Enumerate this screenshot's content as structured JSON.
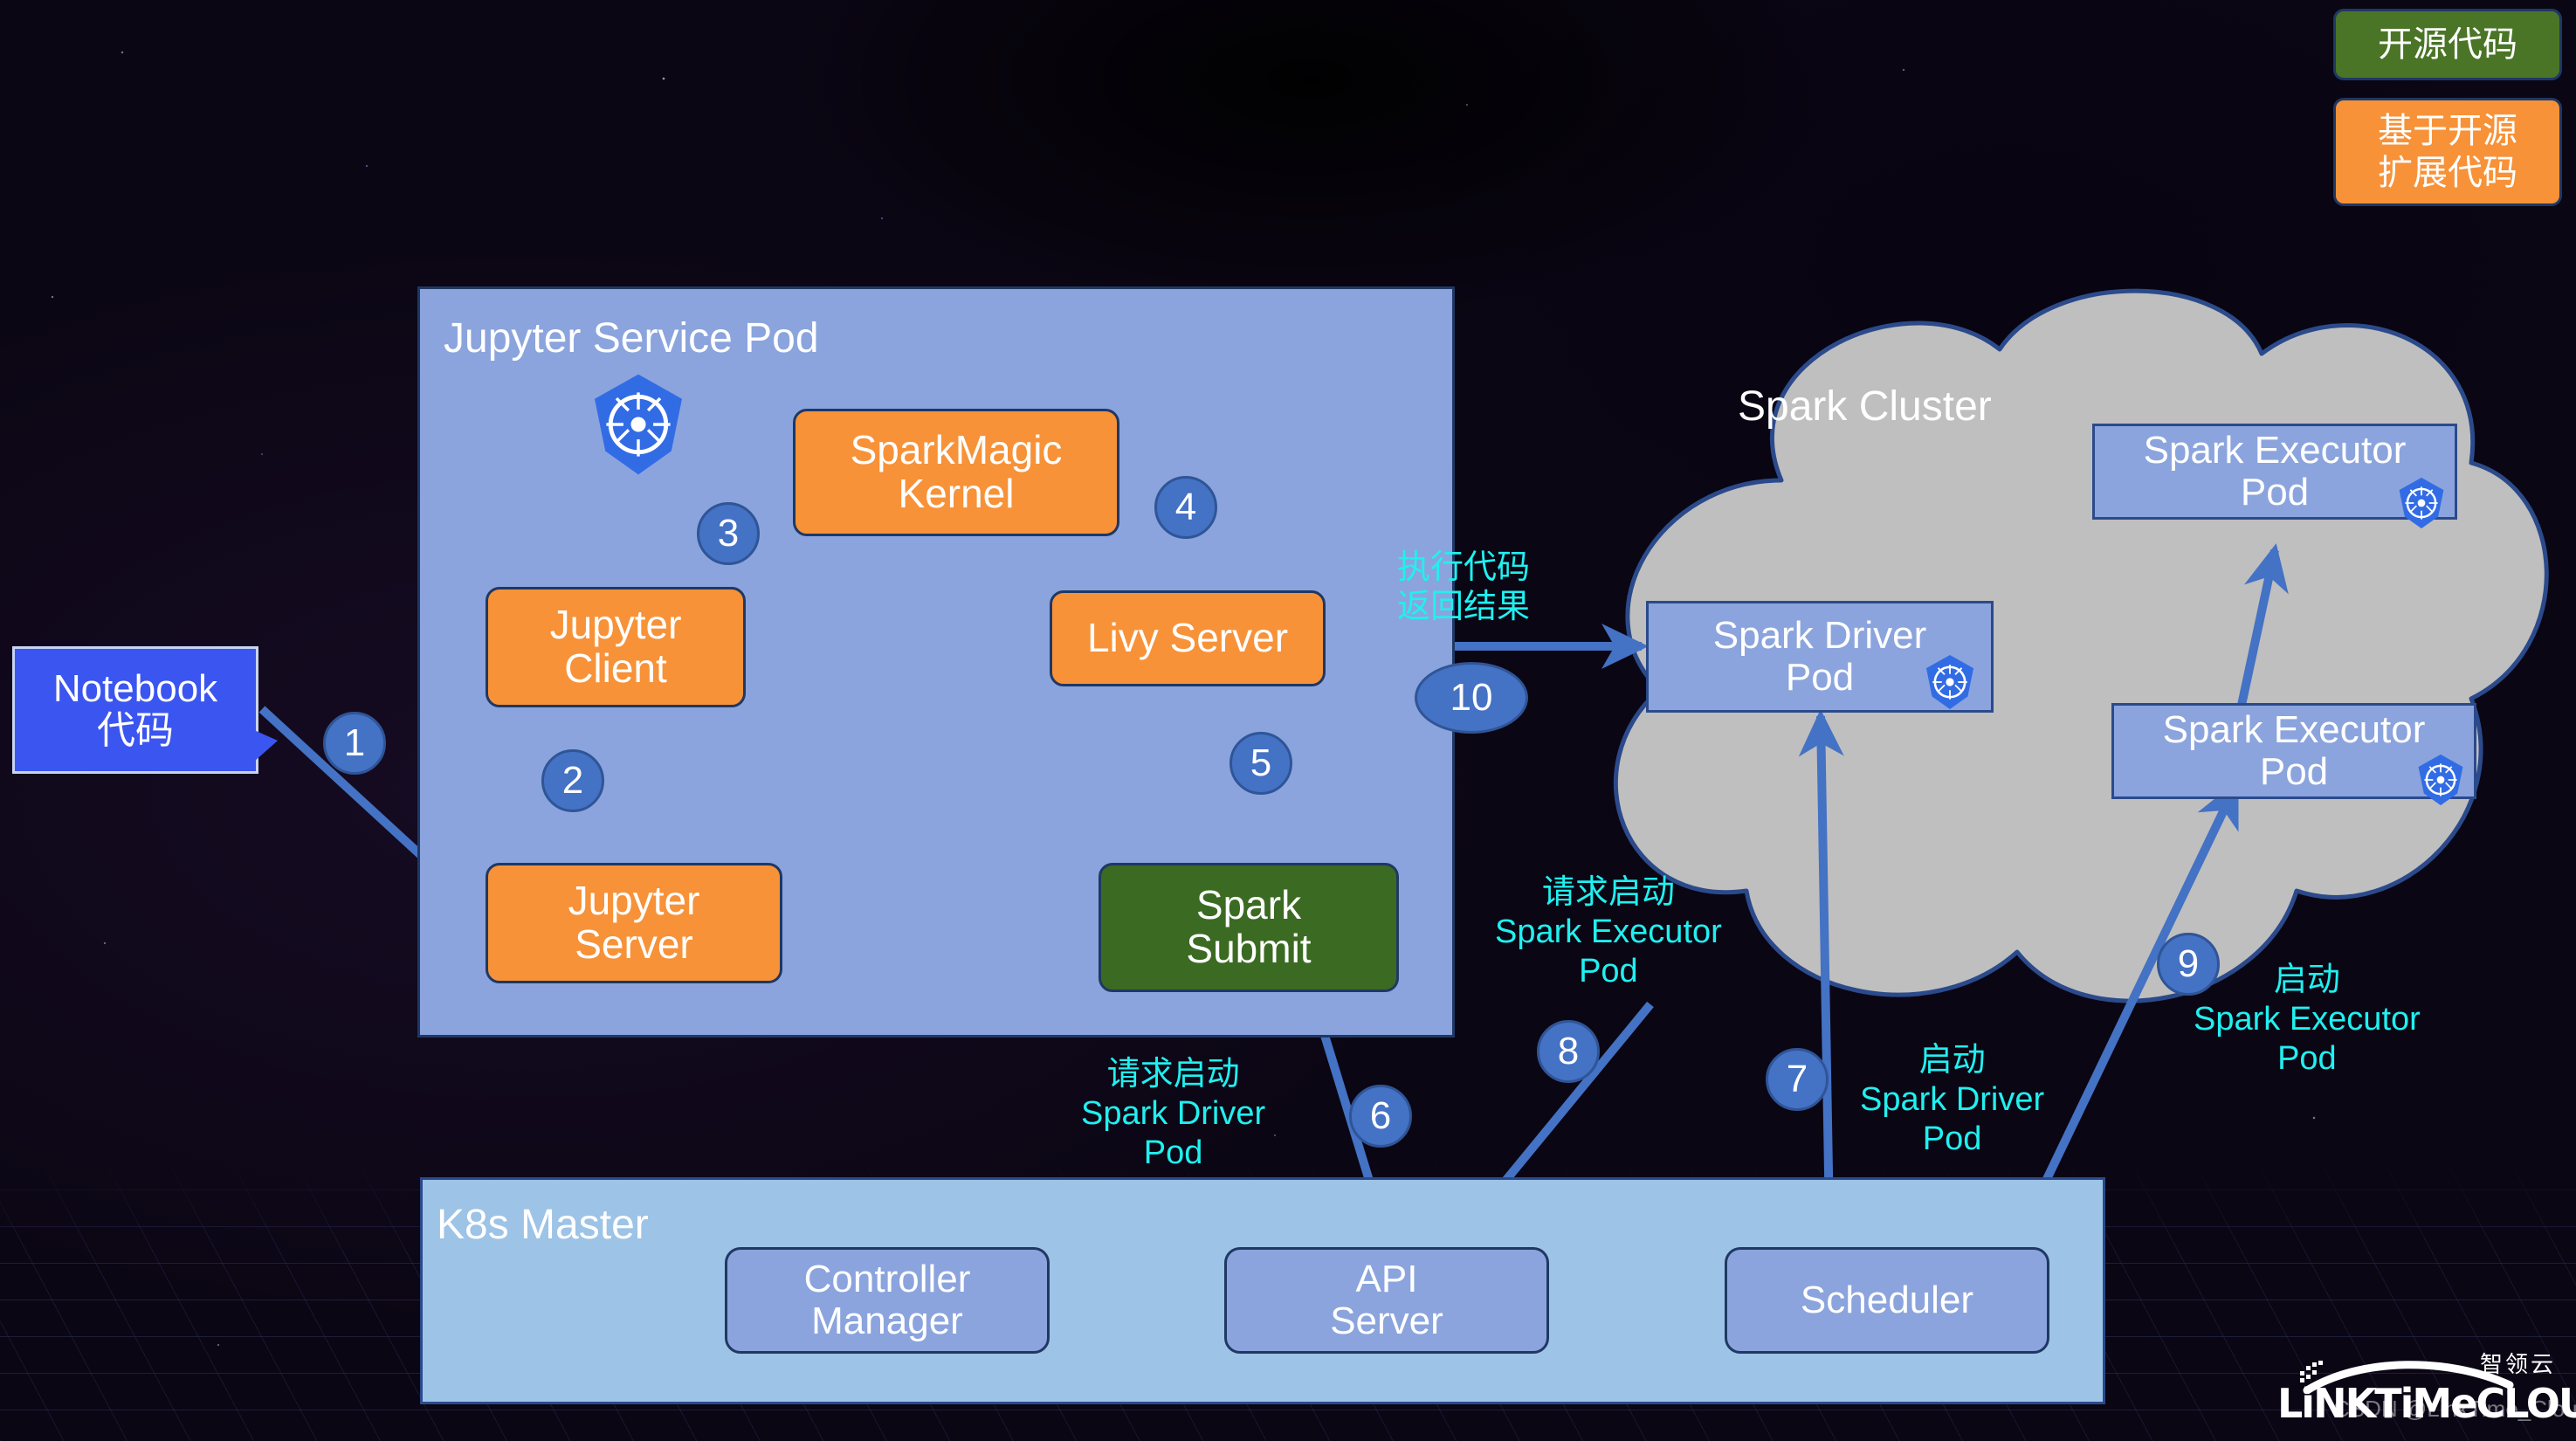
{
  "legend": {
    "open_source": "开源代码",
    "extended": "基于开源\n扩展代码"
  },
  "containers": {
    "jupyter_pod_title": "Jupyter Service Pod",
    "k8s_master_title": "K8s Master",
    "spark_cluster_title": "Spark Cluster"
  },
  "nodes": {
    "notebook_line1": "Notebook",
    "notebook_line2": "代码",
    "jupyter_client": "Jupyter\nClient",
    "jupyter_server": "Jupyter\nServer",
    "sparkmagic_kernel": "SparkMagic\nKernel",
    "livy_server": "Livy Server",
    "spark_submit": "Spark\nSubmit",
    "spark_driver_pod": "Spark Driver\nPod",
    "spark_executor_pod_1": "Spark Executor\nPod",
    "spark_executor_pod_2": "Spark Executor\nPod",
    "controller_manager": "Controller\nManager",
    "api_server": "API\nServer",
    "scheduler": "Scheduler"
  },
  "steps": {
    "s1": "1",
    "s2": "2",
    "s3": "3",
    "s4": "4",
    "s5": "5",
    "s6": "6",
    "s7": "7",
    "s8": "8",
    "s9": "9",
    "s10": "10"
  },
  "annotations": {
    "exec_return": "执行代码\n返回结果",
    "request_start_driver": "请求启动\nSpark Driver\nPod",
    "request_start_executor": "请求启动\nSpark Executor\nPod",
    "start_driver": "启动\nSpark Driver\nPod",
    "start_executor": "启动\nSpark Executor\nPod"
  },
  "brand": {
    "wordmark": "LiNKTiMeCLOUD",
    "chinese": "智领云",
    "watermark": "CSDN @LinkTime_Cloud"
  },
  "colors": {
    "orange": "#f79238",
    "green": "#3b6b22",
    "lavender": "#8ba4dd",
    "panel_blue": "#9dc3e6",
    "cloud_gray": "#bfbfbf",
    "arrow_blue": "#4472c4",
    "cyan": "#20f0f0",
    "notebook_blue": "#3b55f0",
    "k8s_blue": "#326ce5"
  }
}
